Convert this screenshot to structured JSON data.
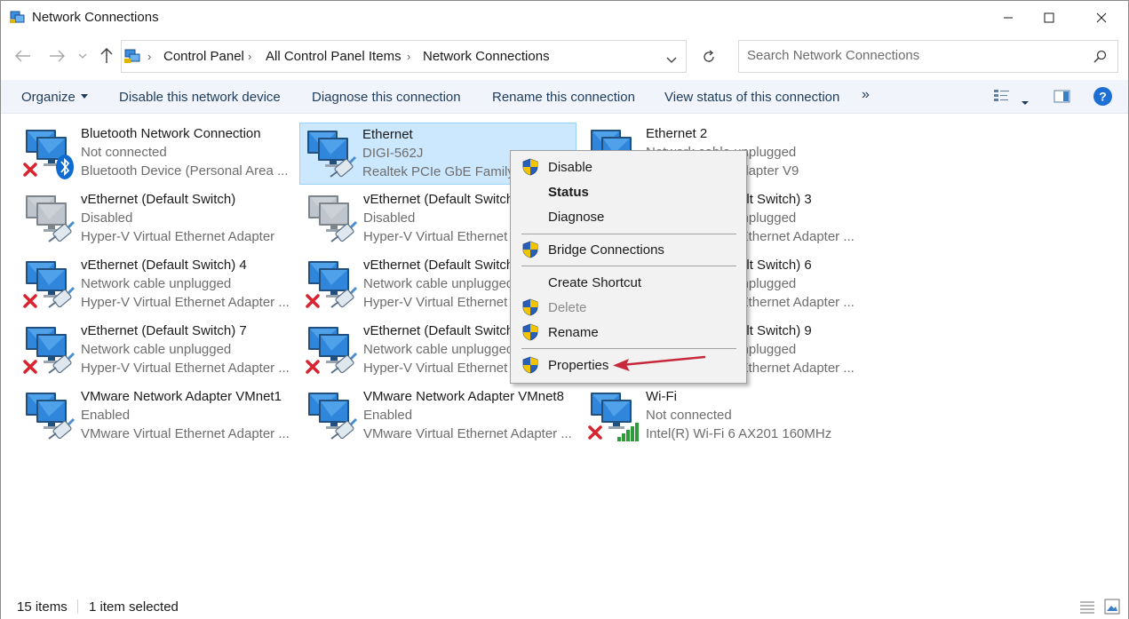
{
  "window": {
    "title": "Network Connections"
  },
  "nav": {
    "back": "back-arrow",
    "forward": "forward-arrow",
    "recent": "chevron-down",
    "up": "up-arrow"
  },
  "address": {
    "crumbs": [
      "Control Panel",
      "All Control Panel Items",
      "Network Connections"
    ]
  },
  "search": {
    "placeholder": "Search Network Connections"
  },
  "commands": {
    "organize": "Organize",
    "disable": "Disable this network device",
    "diagnose": "Diagnose this connection",
    "rename": "Rename this connection",
    "view_status": "View status of this connection",
    "more": "»"
  },
  "items": [
    {
      "name": "Bluetooth Network Connection",
      "status": "Not connected",
      "device": "Bluetooth Device (Personal Area ...",
      "badge": "bluetooth",
      "error": true,
      "selected": false
    },
    {
      "name": "Ethernet",
      "status": "DIGI-562J",
      "device": "Realtek PCIe GbE Family Controller",
      "badge": "cable",
      "error": false,
      "selected": true
    },
    {
      "name": "Ethernet 2",
      "status": "Network cable unplugged",
      "device": "TAP-Windows Adapter V9",
      "badge": "cable",
      "error": true,
      "selected": false
    },
    {
      "name": "vEthernet (Default Switch)",
      "status": "Disabled",
      "device": "Hyper-V Virtual Ethernet Adapter",
      "badge": "cable",
      "error": false,
      "disabled": true,
      "selected": false
    },
    {
      "name": "vEthernet (Default Switch) 2",
      "status": "Disabled",
      "device": "Hyper-V Virtual Ethernet Adapter",
      "badge": "cable",
      "error": false,
      "disabled": true,
      "selected": false
    },
    {
      "name": "vEthernet (Default Switch) 3",
      "status": "Network cable unplugged",
      "device": "Hyper-V Virtual Ethernet Adapter ...",
      "badge": "cable",
      "error": true,
      "selected": false
    },
    {
      "name": "vEthernet (Default Switch) 4",
      "status": "Network cable unplugged",
      "device": "Hyper-V Virtual Ethernet Adapter ...",
      "badge": "cable",
      "error": true,
      "selected": false
    },
    {
      "name": "vEthernet (Default Switch) 5",
      "status": "Network cable unplugged",
      "device": "Hyper-V Virtual Ethernet Adapter ...",
      "badge": "cable",
      "error": true,
      "selected": false
    },
    {
      "name": "vEthernet (Default Switch) 6",
      "status": "Network cable unplugged",
      "device": "Hyper-V Virtual Ethernet Adapter ...",
      "badge": "cable",
      "error": true,
      "selected": false
    },
    {
      "name": "vEthernet (Default Switch) 7",
      "status": "Network cable unplugged",
      "device": "Hyper-V Virtual Ethernet Adapter ...",
      "badge": "cable",
      "error": true,
      "selected": false
    },
    {
      "name": "vEthernet (Default Switch) 8",
      "status": "Network cable unplugged",
      "device": "Hyper-V Virtual Ethernet Adapter ...",
      "badge": "cable",
      "error": true,
      "selected": false
    },
    {
      "name": "vEthernet (Default Switch) 9",
      "status": "Network cable unplugged",
      "device": "Hyper-V Virtual Ethernet Adapter ...",
      "badge": "cable",
      "error": true,
      "selected": false
    },
    {
      "name": "VMware Network Adapter VMnet1",
      "status": "Enabled",
      "device": "VMware Virtual Ethernet Adapter ...",
      "badge": "cable",
      "error": false,
      "selected": false
    },
    {
      "name": "VMware Network Adapter VMnet8",
      "status": "Enabled",
      "device": "VMware Virtual Ethernet Adapter ...",
      "badge": "cable",
      "error": false,
      "selected": false
    },
    {
      "name": "Wi-Fi",
      "status": "Not connected",
      "device": "Intel(R) Wi-Fi 6 AX201 160MHz",
      "badge": "wifi",
      "error": true,
      "selected": false
    }
  ],
  "context_menu": {
    "items": [
      {
        "label": "Disable",
        "shield": true
      },
      {
        "label": "Status",
        "bold": true
      },
      {
        "label": "Diagnose"
      },
      {
        "label": "Bridge Connections",
        "shield": true
      },
      {
        "label": "Create Shortcut"
      },
      {
        "label": "Delete",
        "shield": true,
        "disabled": true
      },
      {
        "label": "Rename",
        "shield": true
      },
      {
        "label": "Properties",
        "shield": true
      }
    ]
  },
  "annotation": {
    "color": "#c8283c"
  },
  "statusbar": {
    "count": "15 items",
    "selection": "1 item selected"
  },
  "colors": {
    "accent": "#0063b1",
    "selection": "#cce8ff",
    "commandbar": "#f1f5fb",
    "error": "#d9232e"
  }
}
